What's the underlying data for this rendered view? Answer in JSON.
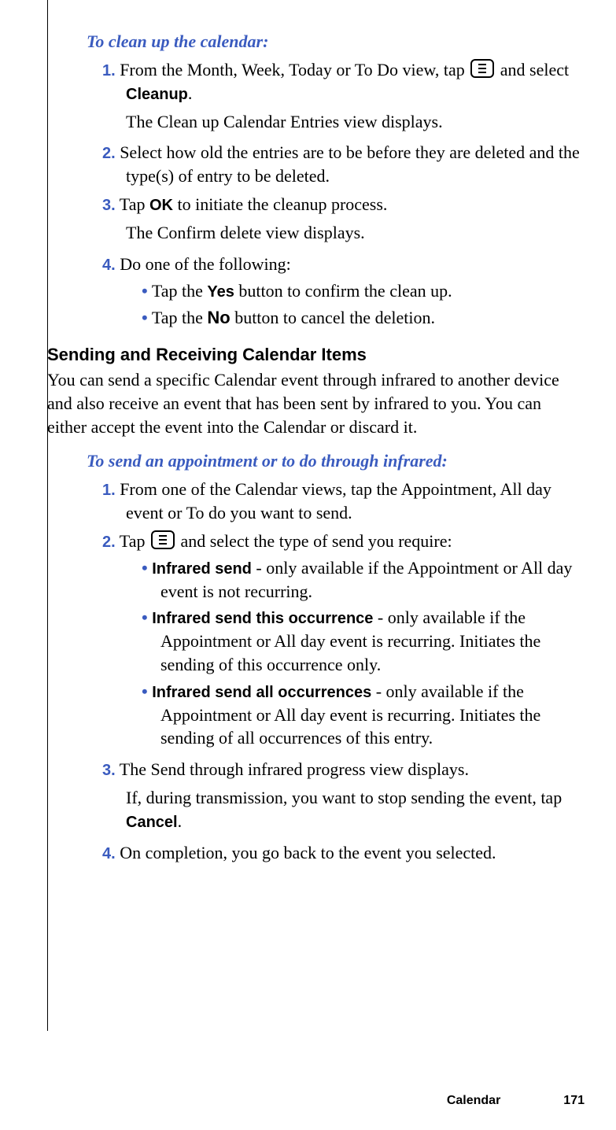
{
  "section1": {
    "task_title": "To clean up the calendar:",
    "step1_num": "1.",
    "step1_a": "From the Month, Week, Today or To Do view, tap ",
    "step1_b": " and select ",
    "step1_bold": "Cleanup",
    "step1_c": ".",
    "step1_result": "The Clean up Calendar Entries view displays.",
    "step2_num": "2.",
    "step2": "Select how old the entries are to be before they are deleted and the type(s) of entry to be deleted.",
    "step3_num": "3.",
    "step3_a": "Tap ",
    "step3_bold": "OK",
    "step3_b": " to initiate the cleanup process.",
    "step3_result": "The Confirm delete view displays.",
    "step4_num": "4.",
    "step4": "Do one of the following:",
    "bullet_yes_a": "Tap the ",
    "bullet_yes_bold": "Yes",
    "bullet_yes_b": " button to confirm the clean up.",
    "bullet_no_a": "Tap the ",
    "bullet_no_bold": "No",
    "bullet_no_b": " button to cancel the deletion."
  },
  "section2": {
    "heading": "Sending and Receiving Calendar Items",
    "intro": "You can send a specific Calendar event through infrared to another device and also receive an event that has been sent by infrared to you. You can either accept the event into the Calendar or discard it.",
    "task_title": "To send an appointment or to do through infrared:",
    "step1_num": "1.",
    "step1": "From one of the Calendar views, tap the Appointment, All day event or To do you want to send.",
    "step2_num": "2.",
    "step2_a": "Tap ",
    "step2_b": " and select the type of send you require:",
    "bullet1_bold": "Infrared send",
    "bullet1_rest": " - only available if the Appointment or All day event is not recurring.",
    "bullet2_bold": "Infrared send this occurrence",
    "bullet2_rest": " - only available if the Appointment or All day event is recurring. Initiates the sending of this occurrence only.",
    "bullet3_bold": "Infrared send all occurrences",
    "bullet3_rest": " - only available if the Appointment or All day event is recurring. Initiates the sending of all occurrences of this entry.",
    "step3_num": "3.",
    "step3": "The Send through infrared progress view displays.",
    "step3_result_a": "If, during transmission, you want to stop sending the event, tap ",
    "step3_result_bold": "Cancel",
    "step3_result_b": ".",
    "step4_num": "4.",
    "step4": "On completion, you go back to the event you selected."
  },
  "footer": {
    "section": "Calendar",
    "page": "171"
  }
}
